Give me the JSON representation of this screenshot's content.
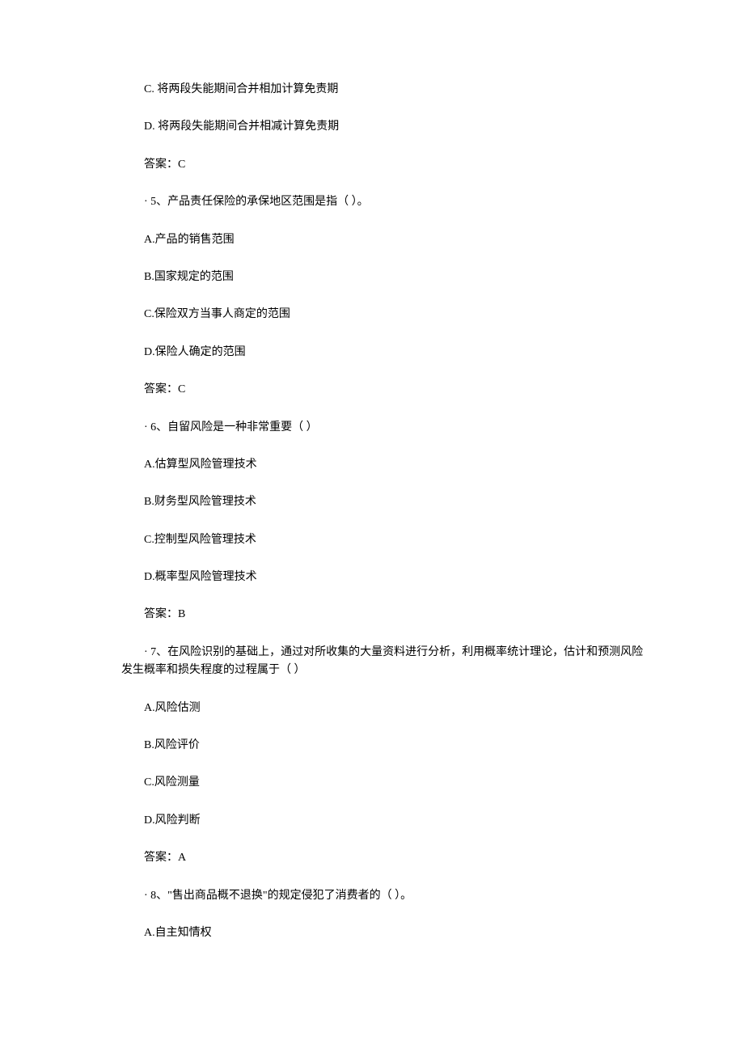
{
  "lines": [
    "C. 将两段失能期间合并相加计算免责期",
    "D. 将两段失能期间合并相减计算免责期",
    "答案：C",
    "· 5、产品责任保险的承保地区范围是指（ ）。",
    "A.产品的销售范围",
    "B.国家规定的范围",
    "C.保险双方当事人商定的范围",
    "D.保险人确定的范围",
    "答案：C",
    "· 6、自留风险是一种非常重要（ ）",
    "A.估算型风险管理技术",
    "B.财务型风险管理技术",
    "C.控制型风险管理技术",
    "D.概率型风险管理技术",
    "答案：B",
    "· 7、在风险识别的基础上，通过对所收集的大量资料进行分析，利用概率统计理论，估计和预测风险发生概率和损失程度的过程属于（ ）",
    "A.风险估测",
    "B.风险评价",
    "C.风险测量",
    "D.风险判断",
    "答案：A",
    "· 8、\"售出商品概不退换\"的规定侵犯了消费者的（ ）。",
    "A.自主知情权"
  ]
}
